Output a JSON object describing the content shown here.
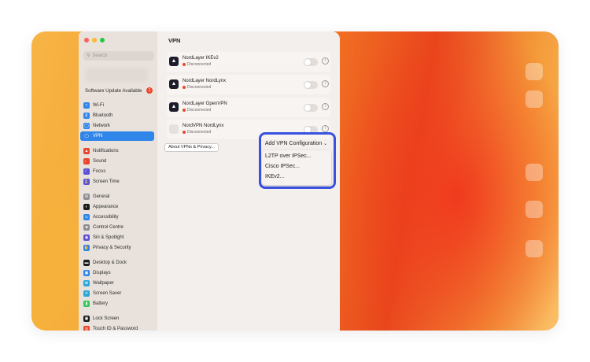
{
  "colors": {
    "accent": "#2f86e8",
    "highlight": "#3b51e0",
    "status_red": "#e8462d",
    "window_bg": "#f3efec",
    "sidebar_bg": "#e9e2dc"
  },
  "window_controls": [
    "close",
    "minimize",
    "zoom"
  ],
  "sidebar": {
    "search_placeholder": "Search",
    "update_label": "Software Update Available",
    "update_count": "1",
    "items": [
      {
        "label": "Wi-Fi",
        "icon": "wifi-icon",
        "color": "#2f86e8",
        "active": false
      },
      {
        "label": "Bluetooth",
        "icon": "bluetooth-icon",
        "color": "#2f86e8",
        "active": false
      },
      {
        "label": "Network",
        "icon": "globe-icon",
        "color": "#2f86e8",
        "active": false
      },
      {
        "label": "VPN",
        "icon": "globe-icon",
        "color": "#2f86e8",
        "active": true
      },
      {
        "label": "Notifications",
        "icon": "bell-icon",
        "color": "#e8462d",
        "active": false
      },
      {
        "label": "Sound",
        "icon": "speaker-icon",
        "color": "#e8462d",
        "active": false
      },
      {
        "label": "Focus",
        "icon": "moon-icon",
        "color": "#5b4fd6",
        "active": false
      },
      {
        "label": "Screen Time",
        "icon": "hourglass-icon",
        "color": "#5b4fd6",
        "active": false
      },
      {
        "label": "General",
        "icon": "gear-icon",
        "color": "#8e8e93",
        "active": false
      },
      {
        "label": "Appearance",
        "icon": "appearance-icon",
        "color": "#1b1b1b",
        "active": false
      },
      {
        "label": "Accessibility",
        "icon": "accessibility-icon",
        "color": "#2f86e8",
        "active": false
      },
      {
        "label": "Control Centre",
        "icon": "control-centre-icon",
        "color": "#8e8e93",
        "active": false
      },
      {
        "label": "Siri & Spotlight",
        "icon": "siri-icon",
        "color": "#5b4fd6",
        "active": false
      },
      {
        "label": "Privacy & Security",
        "icon": "hand-icon",
        "color": "#2f86e8",
        "active": false
      },
      {
        "label": "Desktop & Dock",
        "icon": "dock-icon",
        "color": "#1b1b1b",
        "active": false
      },
      {
        "label": "Displays",
        "icon": "display-icon",
        "color": "#2f86e8",
        "active": false
      },
      {
        "label": "Wallpaper",
        "icon": "wallpaper-icon",
        "color": "#2aa6d8",
        "active": false
      },
      {
        "label": "Screen Saver",
        "icon": "screensaver-icon",
        "color": "#2aa6d8",
        "active": false
      },
      {
        "label": "Battery",
        "icon": "battery-icon",
        "color": "#34c759",
        "active": false
      },
      {
        "label": "Lock Screen",
        "icon": "lock-icon",
        "color": "#1b1b1b",
        "active": false
      },
      {
        "label": "Touch ID & Password",
        "icon": "fingerprint-icon",
        "color": "#e8462d",
        "active": false
      }
    ]
  },
  "content": {
    "title": "VPN",
    "vpns": [
      {
        "name": "NordLayer IKEv2",
        "status": "Disconnected",
        "logo": "nordlayer-logo"
      },
      {
        "name": "NordLayer NordLynx",
        "status": "Disconnected",
        "logo": "nordlayer-logo"
      },
      {
        "name": "NordLayer OpenVPN",
        "status": "Disconnected",
        "logo": "nordlayer-logo"
      },
      {
        "name": "NordVPN NordLynx",
        "status": "Disconnected",
        "logo": "blank-logo"
      }
    ],
    "about_button": "About VPNs & Privacy...",
    "add_button": "Add VPN Configuration",
    "menu_items": [
      "L2TP over IPSec...",
      "Cisco IPSec...",
      "IKEv2..."
    ]
  }
}
